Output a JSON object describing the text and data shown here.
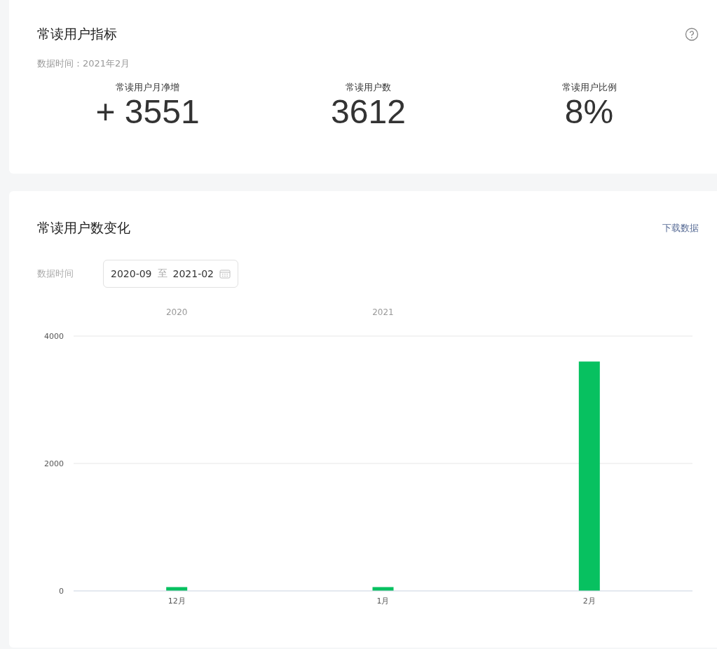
{
  "metrics_card": {
    "title": "常读用户指标",
    "data_time": "数据时间：2021年2月",
    "metrics": [
      {
        "label": "常读用户月净增",
        "value": "+ 3551"
      },
      {
        "label": "常读用户数",
        "value": "3612"
      },
      {
        "label": "常读用户比例",
        "value": "8%"
      }
    ]
  },
  "trend_card": {
    "title": "常读用户数变化",
    "download_link": "下载数据",
    "date_label": "数据时间",
    "date_range": {
      "start": "2020-09",
      "separator": "至",
      "end": "2021-02"
    },
    "year_labels": [
      "2020",
      "2021"
    ],
    "chart_data": {
      "type": "bar",
      "categories": [
        "12月",
        "1月",
        "2月"
      ],
      "values": [
        60,
        60,
        3600
      ],
      "ylim": [
        0,
        4000
      ],
      "yticks": [
        0,
        2000,
        4000
      ]
    }
  }
}
